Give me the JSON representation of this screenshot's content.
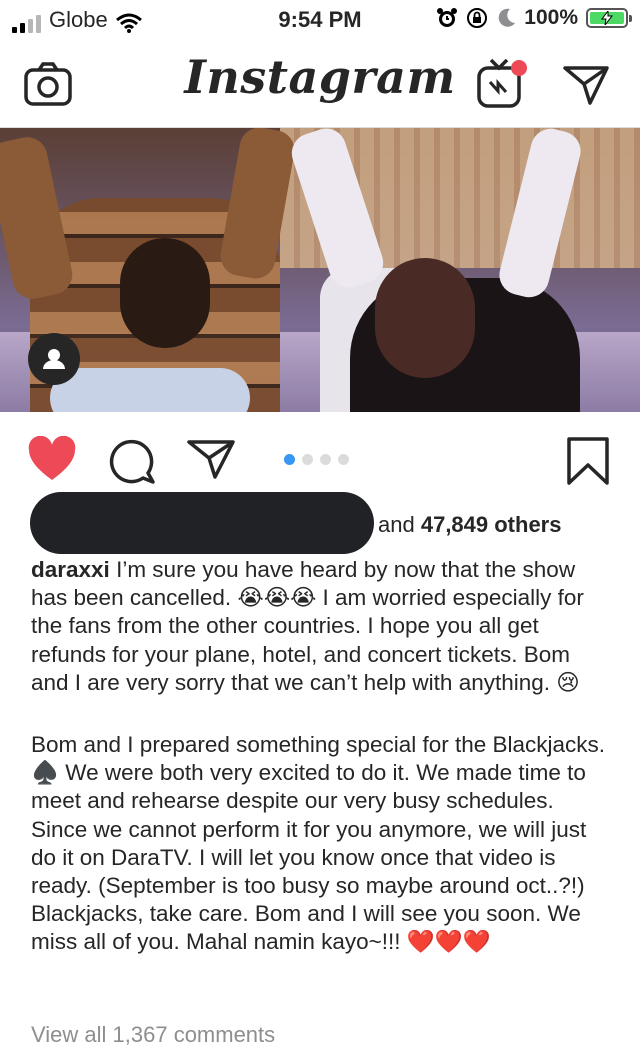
{
  "status_bar": {
    "carrier": "Globe",
    "time": "9:54 PM",
    "battery": "100%"
  },
  "nav": {
    "logo": "Instagram",
    "left_icon": "camera-icon",
    "right_icons": [
      "igtv-icon",
      "direct-message-icon"
    ],
    "notification_color": "#ed4956"
  },
  "post": {
    "carousel_pages": 4,
    "carousel_active": 1,
    "liked": true,
    "like_color": "#ed4956",
    "likes_text": "and",
    "likes_count": "47,849 others",
    "caption_user": "daraxxi",
    "caption_p1_a": " I’m sure you have heard by now that the show has been cancelled. ",
    "caption_p1_emoji1": "😭😭😭",
    "caption_p1_b": " I am worried especially for the fans from the other countries. I hope you all get refunds for your plane, hotel, and concert tickets. Bom and I are very sorry that we can’t help with anything. ",
    "caption_p1_emoji2": "😢",
    "caption_p2_a": "Bom and I prepared something special for the Blackjacks. ",
    "caption_p2_spade": "♠️",
    "caption_p2_b": " We were both very excited to do it. We made time to meet and rehearse despite our very busy schedules. Since we cannot perform it for you anymore, we will just do it on DaraTV. I will let you know once that video is ready. (September is too busy so maybe around oct..?!) Blackjacks, take care. Bom and I will see you soon. We miss all of you. Mahal namin kayo~!!! ",
    "caption_p2_hearts": "❤️❤️❤️",
    "view_comments": "View all 1,367 comments"
  }
}
